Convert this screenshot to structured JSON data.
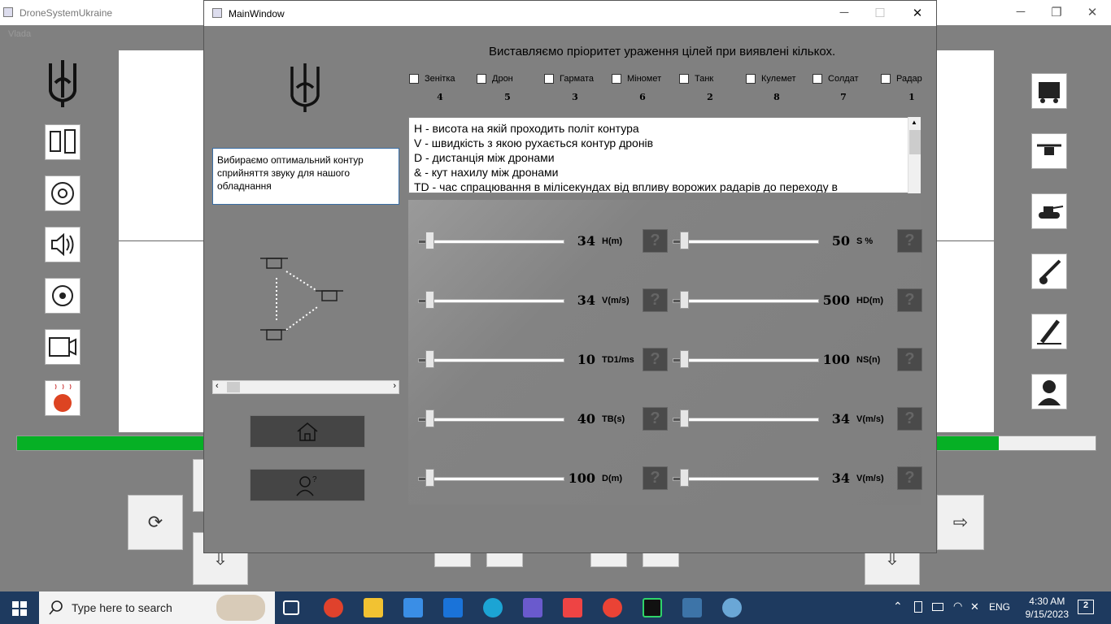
{
  "bg_window": {
    "title": "DroneSystemUkraine",
    "faded_label": "Vlada"
  },
  "main_window": {
    "title": "MainWindow",
    "heading": "Виставляємо пріоритет ураження цілей при виявлені кількох.",
    "priorities": [
      {
        "label": "Зенітка",
        "value": "4",
        "checked": false
      },
      {
        "label": "Дрон",
        "value": "5",
        "checked": false
      },
      {
        "label": "Гармата",
        "value": "3",
        "checked": false
      },
      {
        "label": "Міномет",
        "value": "6",
        "checked": false
      },
      {
        "label": "Танк",
        "value": "2",
        "checked": false
      },
      {
        "label": "Кулемет",
        "value": "8",
        "checked": false
      },
      {
        "label": "Солдат",
        "value": "7",
        "checked": false
      },
      {
        "label": "Радар",
        "value": "1",
        "checked": false
      }
    ],
    "left_text": "Вибираємо оптимальний контур сприйняття звуку для нашого обладнання",
    "description_lines": [
      "H - висота на якій проходить політ контура",
      "V - швидкість з якою рухається контур дронів",
      "D - дистанція між дронами",
      "& - кут нахилу між дронами",
      "TD - час спрацювання в мілісекундах від впливу ворожих радарів до переходу в"
    ],
    "sliders_left": [
      {
        "value": "34",
        "label": "H(m)",
        "level": 0.05
      },
      {
        "value": "34",
        "label": "V(m/s)",
        "level": 0.05
      },
      {
        "value": "10",
        "label": "TD1/ms",
        "level": 0.05
      },
      {
        "value": "40",
        "label": "TB(s)",
        "level": 0.05
      },
      {
        "value": "100",
        "label": "D(m)",
        "level": 0.05
      }
    ],
    "sliders_right": [
      {
        "value": "50",
        "label": "S %",
        "level": 0.05
      },
      {
        "value": "500",
        "label": "HD(m)",
        "level": 0.05
      },
      {
        "value": "100",
        "label": "NS(n)",
        "level": 0.05
      },
      {
        "value": "34",
        "label": "V(m/s)",
        "level": 0.05
      },
      {
        "value": "34",
        "label": "V(m/s)",
        "level": 0.05
      }
    ],
    "help_glyph": "?"
  },
  "progress": {
    "fraction": 0.91,
    "color": "#06b025"
  },
  "taskbar": {
    "search_placeholder": "Type here to search",
    "language": "ENG",
    "time": "4:30 AM",
    "date": "9/15/2023",
    "notification_count": "2"
  }
}
